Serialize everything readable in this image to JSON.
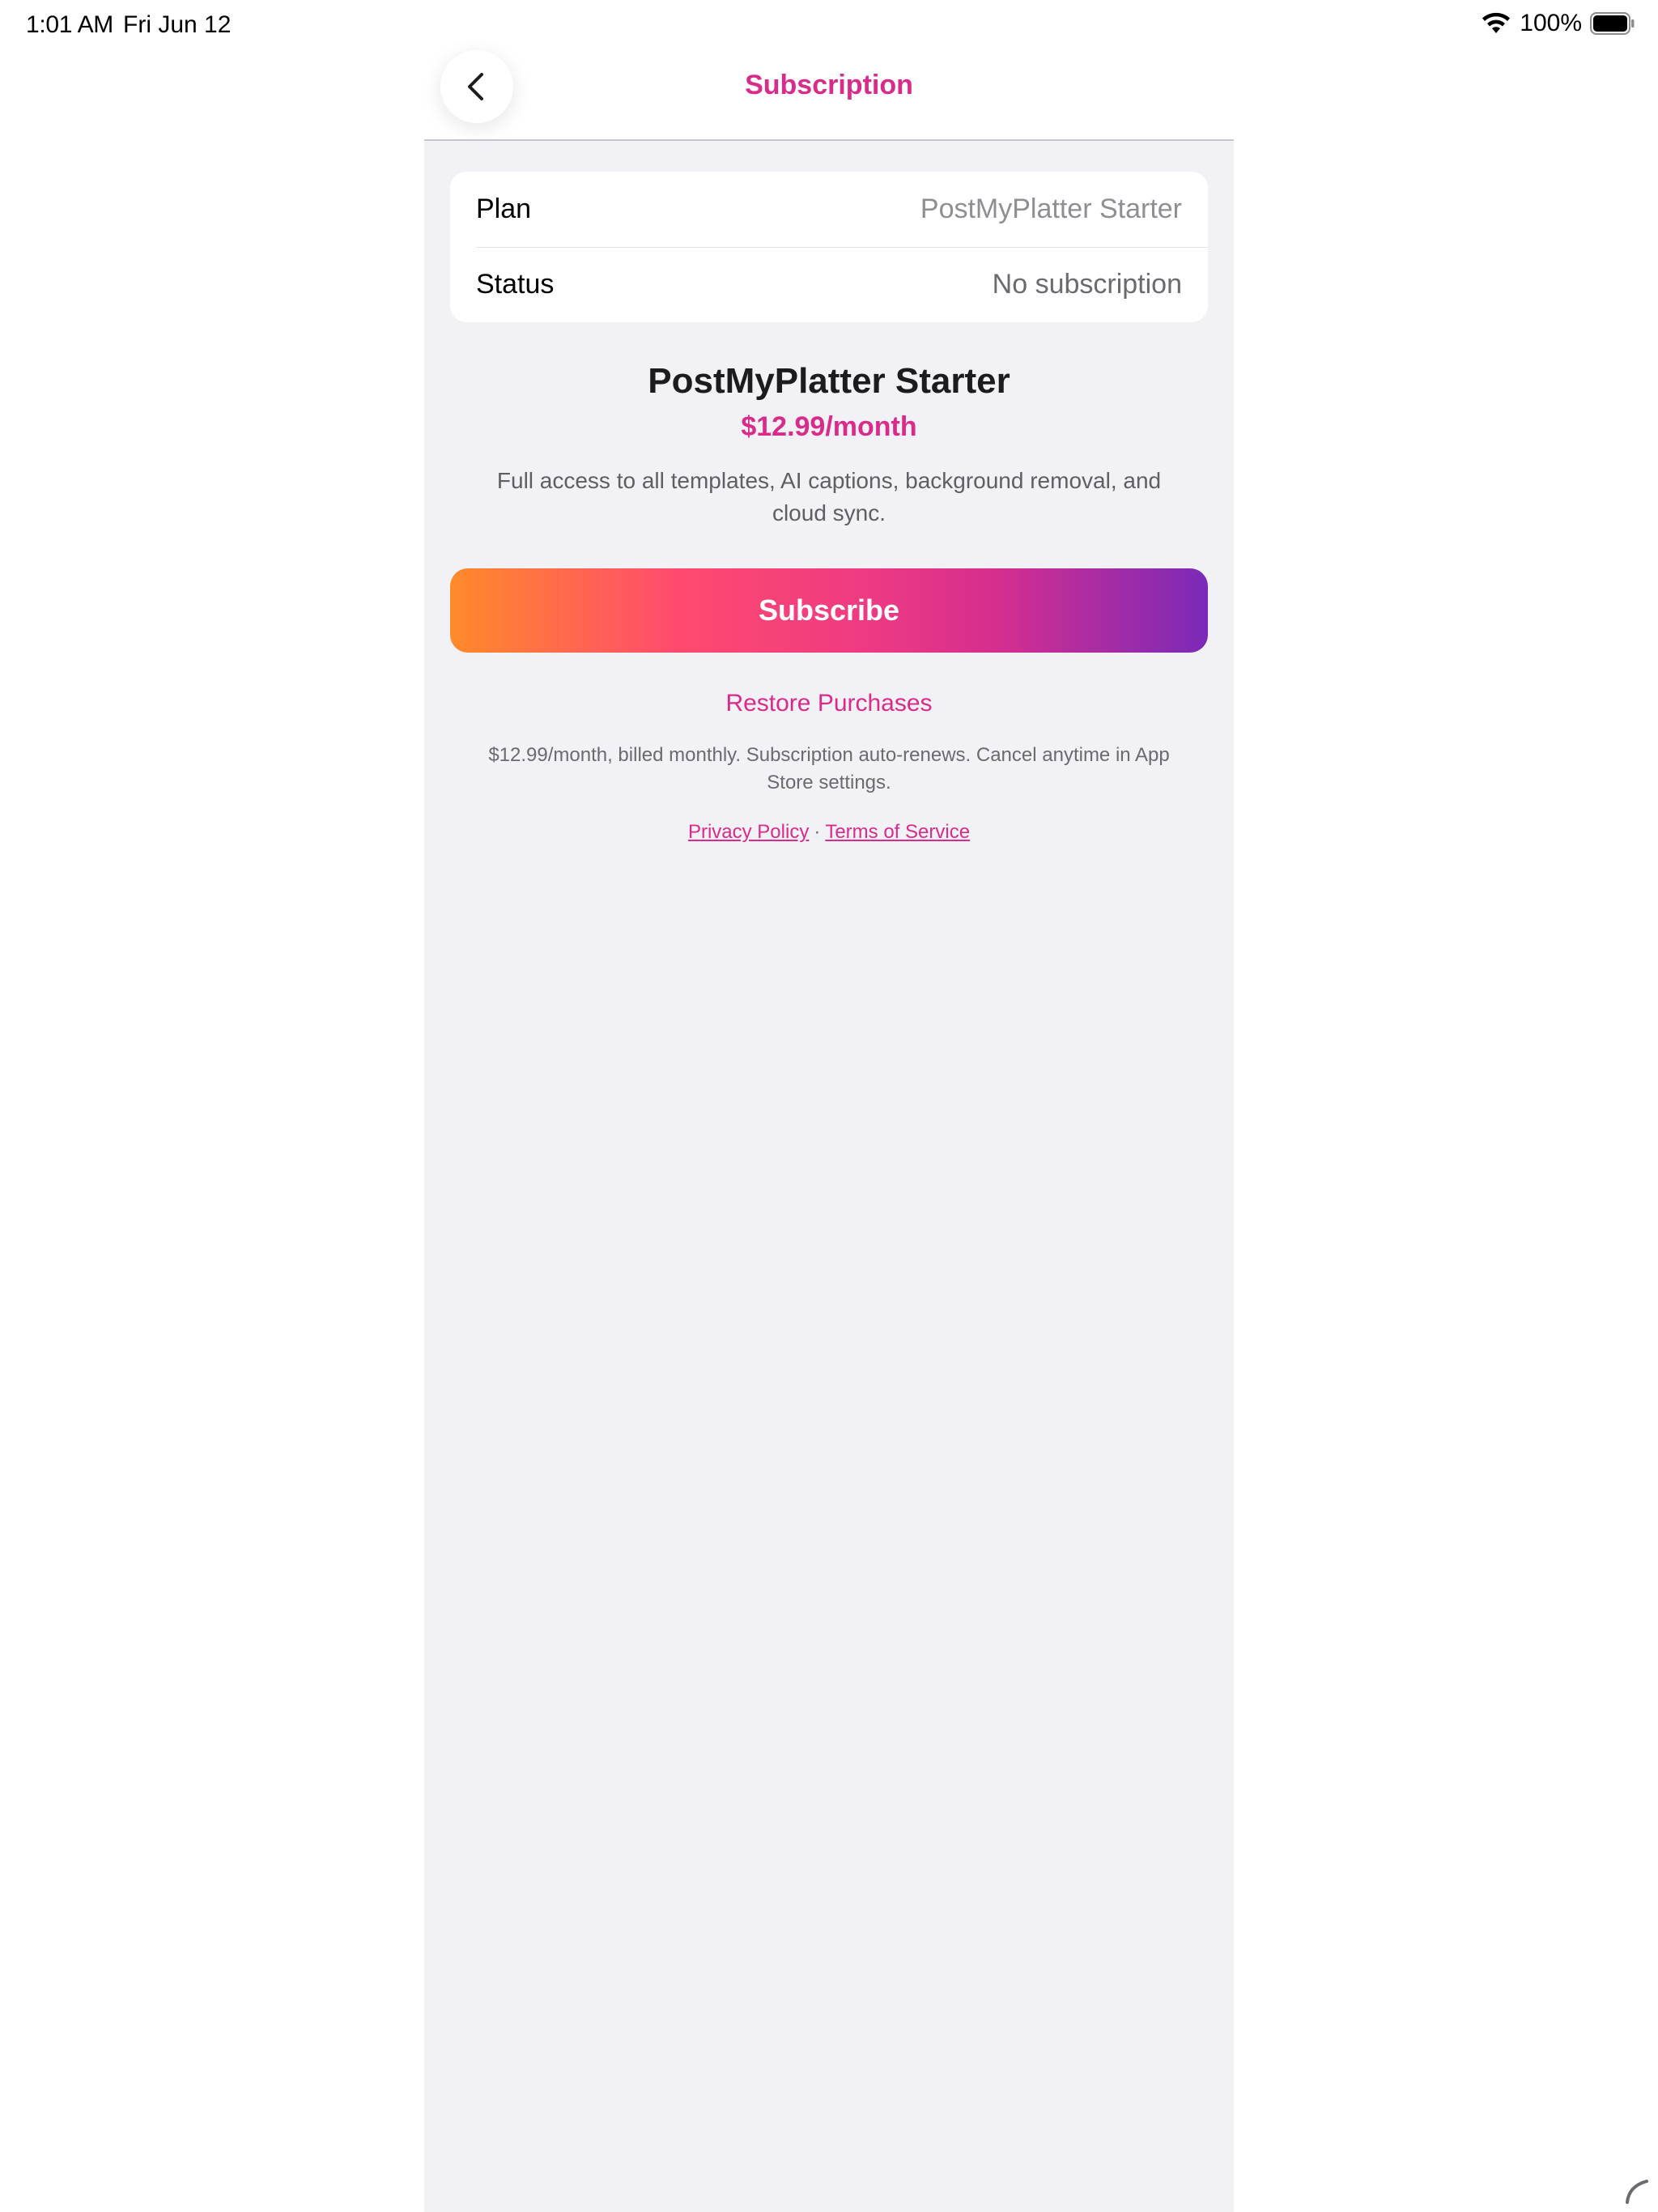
{
  "status_bar": {
    "time": "1:01 AM",
    "date": "Fri Jun 12",
    "battery": "100%",
    "icons": [
      "wifi-icon",
      "battery-icon"
    ]
  },
  "nav": {
    "title": "Subscription",
    "back_icon": "chevron-left-icon"
  },
  "info": {
    "plan_label": "Plan",
    "plan_value": "PostMyPlatter Starter",
    "status_label": "Status",
    "status_value": "No subscription"
  },
  "offer": {
    "name": "PostMyPlatter Starter",
    "price": "$12.99/month",
    "description": "Full access to all templates, AI captions, background removal, and cloud sync."
  },
  "actions": {
    "subscribe": "Subscribe",
    "restore": "Restore Purchases"
  },
  "footer": {
    "billing_note": "$12.99/month, billed monthly. Subscription auto-renews. Cancel anytime in App Store settings.",
    "privacy": "Privacy Policy",
    "separator": "·",
    "terms": "Terms of Service"
  },
  "colors": {
    "accent": "#d92b8a",
    "panel_background": "#f1f1f6",
    "gradient": [
      "#ff8a2a",
      "#ff4a6e",
      "#d52e8f",
      "#7a2ab8"
    ]
  }
}
